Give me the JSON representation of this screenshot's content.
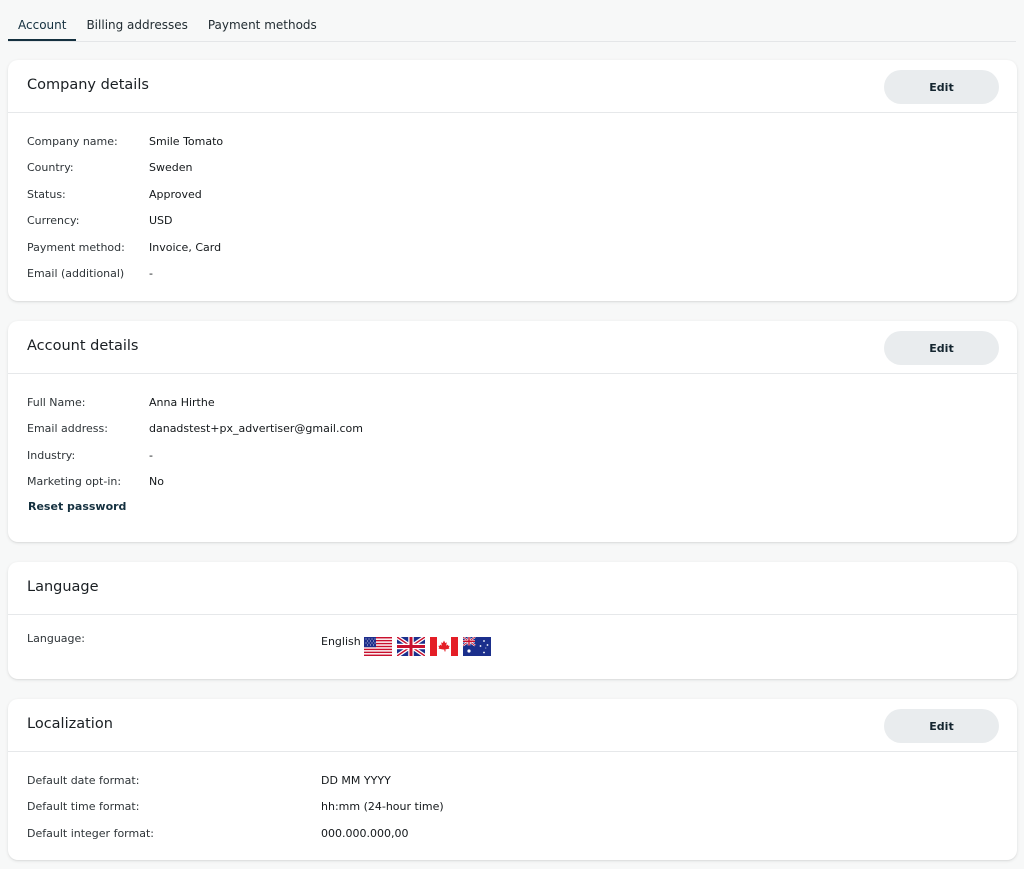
{
  "tabs": [
    {
      "label": "Account",
      "active": true
    },
    {
      "label": "Billing addresses",
      "active": false
    },
    {
      "label": "Payment methods",
      "active": false
    }
  ],
  "company": {
    "title": "Company details",
    "edit_label": "Edit",
    "rows": [
      {
        "label": "Company name:",
        "value": "Smile Tomato"
      },
      {
        "label": "Country:",
        "value": "Sweden"
      },
      {
        "label": "Status:",
        "value": "Approved"
      },
      {
        "label": "Currency:",
        "value": "USD"
      },
      {
        "label": "Payment method:",
        "value": "Invoice, Card"
      },
      {
        "label": "Email (additional)",
        "value": "-"
      }
    ]
  },
  "account": {
    "title": "Account details",
    "edit_label": "Edit",
    "rows": [
      {
        "label": "Full Name:",
        "value": "Anna Hirthe"
      },
      {
        "label": "Email address:",
        "value": "danadstest+px_advertiser@gmail.com"
      },
      {
        "label": "Industry:",
        "value": "-"
      },
      {
        "label": "Marketing opt-in:",
        "value": "No"
      }
    ],
    "reset_password": "Reset password"
  },
  "language": {
    "title": "Language",
    "label": "Language:",
    "value": "English",
    "flags": [
      "us-flag-icon",
      "uk-flag-icon",
      "canada-flag-icon",
      "australia-flag-icon"
    ]
  },
  "localization": {
    "title": "Localization",
    "edit_label": "Edit",
    "rows": [
      {
        "label": "Default date format:",
        "value": "DD MM YYYY"
      },
      {
        "label": "Default time format:",
        "value": "hh:mm (24-hour time)"
      },
      {
        "label": "Default integer format:",
        "value": "000.000.000,00"
      }
    ]
  },
  "colors": {
    "accent": "#14303f",
    "link": "#2368b7",
    "button_bg": "#e9ecee"
  }
}
